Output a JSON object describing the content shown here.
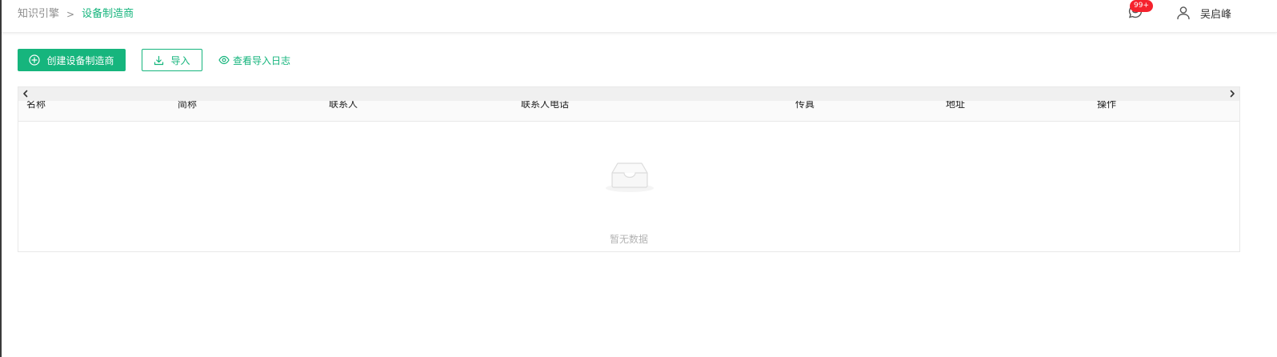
{
  "header": {
    "breadcrumb": {
      "parent": "知识引擎",
      "separator": ">",
      "current": "设备制造商"
    },
    "notifications": {
      "badge": "99+",
      "icon": "message-icon"
    },
    "user": {
      "name": "吴启峰",
      "icon": "user-icon"
    }
  },
  "toolbar": {
    "create_label": "创建设备制造商",
    "import_label": "导入",
    "view_log_label": "查看导入日志"
  },
  "table": {
    "columns": [
      "名称",
      "简称",
      "联系人",
      "联系人电话",
      "传真",
      "地址",
      "操作"
    ],
    "rows": [],
    "empty_text": "暂无数据"
  },
  "colors": {
    "accent": "#16b57d",
    "badge": "#f5222d",
    "muted_text": "#8c8c8c"
  }
}
